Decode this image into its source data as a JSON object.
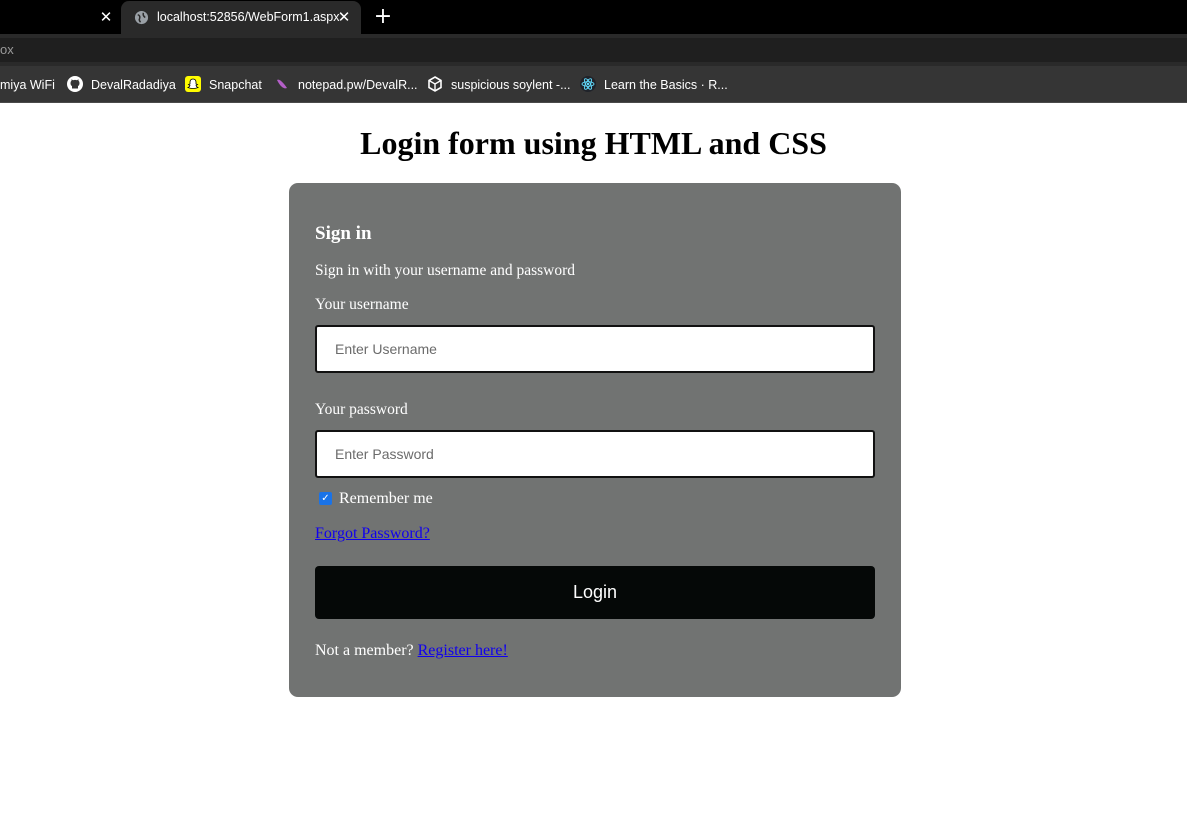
{
  "browser": {
    "tab_title": "localhost:52856/WebForm1.aspx",
    "address_fragment": "ox",
    "bookmarks": [
      {
        "label": "miya WiFi",
        "icon": "none"
      },
      {
        "label": "DevalRadadiya",
        "icon": "github-icon"
      },
      {
        "label": "Snapchat",
        "icon": "snapchat-icon"
      },
      {
        "label": "notepad.pw/DevalR...",
        "icon": "notepad-icon"
      },
      {
        "label": "suspicious soylent -...",
        "icon": "codesandbox-icon"
      },
      {
        "label": "Learn the Basics · R...",
        "icon": "react-icon"
      }
    ]
  },
  "page": {
    "heading": "Login form using HTML and CSS"
  },
  "form": {
    "title": "Sign in",
    "subtitle": "Sign in with your username and password",
    "username_label": "Your username",
    "username_placeholder": "Enter Username",
    "username_value": "",
    "password_label": "Your password",
    "password_placeholder": "Enter Password",
    "password_value": "",
    "remember_label": "Remember me",
    "remember_checked": true,
    "forgot_link": "Forgot Password?",
    "login_button": "Login",
    "footer_text": "Not a member?",
    "register_link": "Register here!"
  },
  "colors": {
    "card_bg": "#717372",
    "button_bg": "#050807",
    "link": "#1000ee",
    "checkbox": "#1a73e8"
  }
}
